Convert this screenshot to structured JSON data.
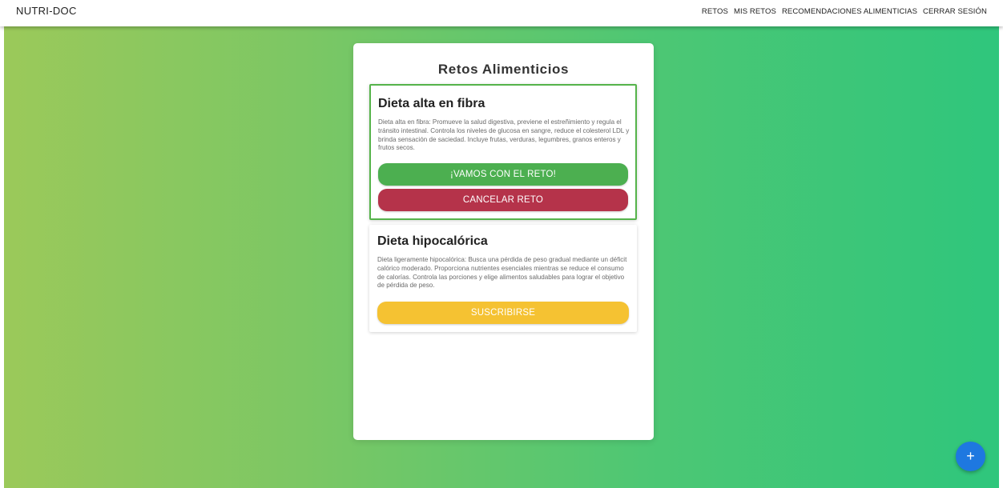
{
  "app": {
    "brand": "NUTRI-DOC"
  },
  "nav": {
    "items": [
      "RETOS",
      "MIS RETOS",
      "RECOMENDACIONES ALIMENTICIAS",
      "CERRAR SESIÓN"
    ]
  },
  "panel": {
    "title": "Retos Alimenticios"
  },
  "cards": [
    {
      "title": "Dieta alta en fibra",
      "description": "Dieta alta en fibra: Promueve la salud digestiva, previene el estreñimiento y regula el tránsito intestinal. Controla los niveles de glucosa en sangre, reduce el colesterol LDL y brinda sensación de saciedad. Incluye frutas, verduras, legumbres, granos enteros y frutos secos.",
      "primary_label": "¡VAMOS CON EL RETO!",
      "secondary_label": "CANCELAR RETO"
    },
    {
      "title": "Dieta hipocalórica",
      "description": "Dieta ligeramente hipocalórica: Busca una pérdida de peso gradual mediante un déficit calórico moderado. Proporciona nutrientes esenciales mientras se reduce el consumo de calorías. Controla las porciones y elige alimentos saludables para lograr el objetivo de pérdida de peso.",
      "primary_label": "SUSCRIBIRSE"
    }
  ],
  "fab": {
    "label": "+",
    "icon": "plus-icon"
  },
  "colors": {
    "accent_green": "#4caf50",
    "danger_red": "#b5334a",
    "warning_yellow": "#f5c232",
    "fab_blue": "#1e78e0"
  }
}
